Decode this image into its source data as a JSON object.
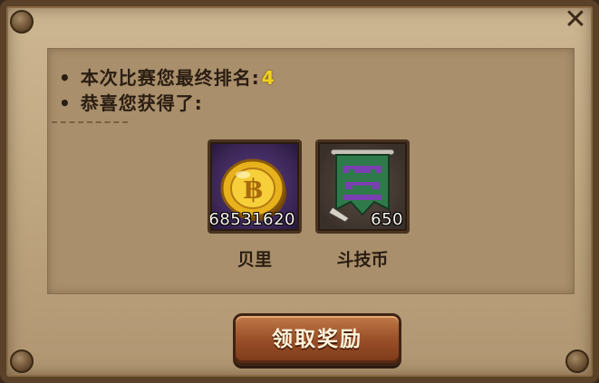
{
  "dialog": {
    "close_icon": "close-x-icon"
  },
  "info": {
    "bullet": "•",
    "rank_label": "本次比赛您最终排名:",
    "rank_value": "4",
    "congrats": "恭喜您获得了:"
  },
  "rewards": [
    {
      "name": "贝里",
      "count": "68531620",
      "icon": "gold-coin-icon",
      "slot_color": "#3a2554"
    },
    {
      "name": "斗技币",
      "count": "650",
      "icon": "green-banner-icon",
      "slot_color": "#3a302a"
    }
  ],
  "claim_button": {
    "label": "领取奖励"
  },
  "colors": {
    "rank_value": "#f3d21a",
    "button": "#9a4f28",
    "panel": "#a98f6b"
  }
}
